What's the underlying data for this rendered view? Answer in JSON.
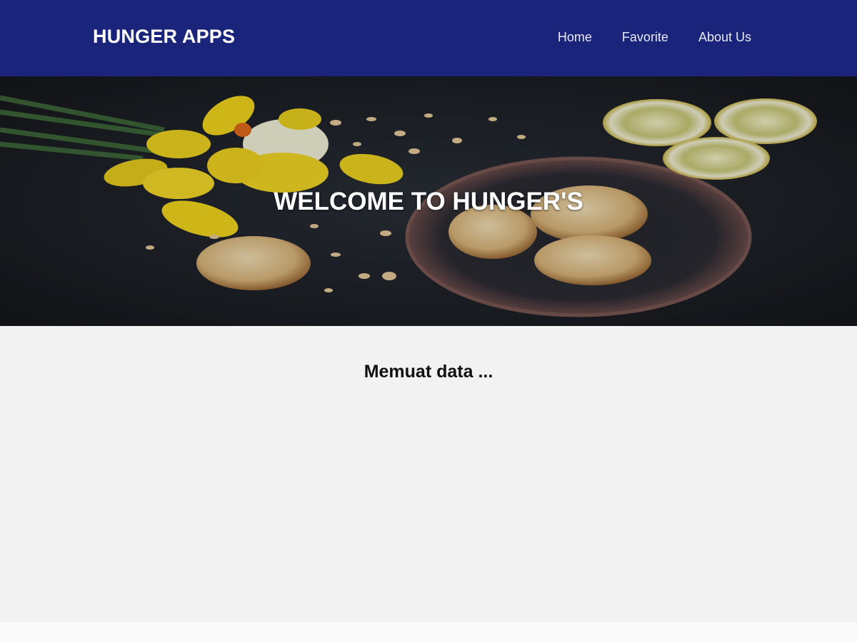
{
  "header": {
    "brand": "HUNGER APPS",
    "nav": [
      {
        "label": "Home"
      },
      {
        "label": "Favorite"
      },
      {
        "label": "About Us"
      }
    ],
    "background_color": "#19247a"
  },
  "hero": {
    "title": "WELCOME TO HUNGER'S",
    "image": "hero-food-image"
  },
  "main": {
    "loading_text": "Memuat data ..."
  }
}
